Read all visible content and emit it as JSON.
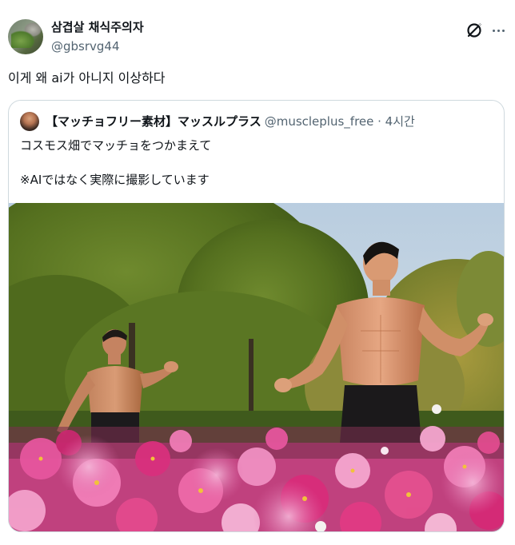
{
  "author": {
    "display_name": "삼겹살 채식주의자",
    "handle": "@gbsrvg44",
    "avatar_icon": "profile-avatar"
  },
  "actions": {
    "grok_icon": "grok-icon",
    "more_icon": "more-options-icon"
  },
  "tweet": {
    "text": "이게 왜 ai가 아니지 이상하다"
  },
  "quoted_tweet": {
    "display_name": "【マッチョフリー素材】マッスルプラス",
    "handle": "@muscleplus_free",
    "time": " · 4시간",
    "line1": "コスモス畑でマッチョをつかまえて",
    "line2": "※AIではなく実際に撮影しています",
    "photo_description_icon": "photo-media"
  },
  "colors": {
    "text_primary": "#0f1419",
    "text_secondary": "#536471",
    "border": "#cfd9de"
  }
}
